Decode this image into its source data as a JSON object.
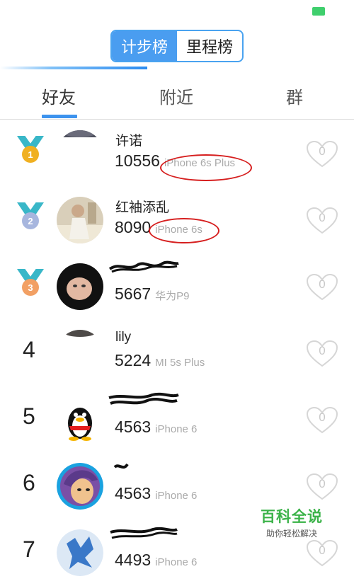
{
  "segment": {
    "tabs": [
      "计步榜",
      "里程榜"
    ],
    "active": 0
  },
  "tabs": [
    {
      "label": "好友",
      "active": true
    },
    {
      "label": "附近",
      "active": false
    },
    {
      "label": "群",
      "active": false
    }
  ],
  "ranking": [
    {
      "rank": "1",
      "medal": "gold",
      "name": "许诺",
      "steps": "10556",
      "device": "iPhone 6s Plus",
      "likes": "0"
    },
    {
      "rank": "2",
      "medal": "silver",
      "name": "红袖添乱",
      "steps": "8090",
      "device": "iPhone 6s",
      "likes": "0"
    },
    {
      "rank": "3",
      "medal": "bronze",
      "name": "",
      "steps": "5667",
      "device": "华为P9",
      "likes": "0"
    },
    {
      "rank": "4",
      "name": "lily",
      "steps": "5224",
      "device": "MI 5s Plus",
      "likes": "0"
    },
    {
      "rank": "5",
      "name": "",
      "steps": "4563",
      "device": "iPhone 6",
      "likes": "0"
    },
    {
      "rank": "6",
      "name": "",
      "steps": "4563",
      "device": "iPhone 6",
      "likes": "0"
    },
    {
      "rank": "7",
      "name": "",
      "steps": "4493",
      "device": "iPhone 6",
      "likes": "0"
    }
  ],
  "watermark": {
    "title": "百科全说",
    "subtitle": "助你轻松解决"
  },
  "colors": {
    "accent": "#4a9df0",
    "battery": "#3fcf6d",
    "annotation": "#d61f1f",
    "watermark": "#3cb34a"
  }
}
